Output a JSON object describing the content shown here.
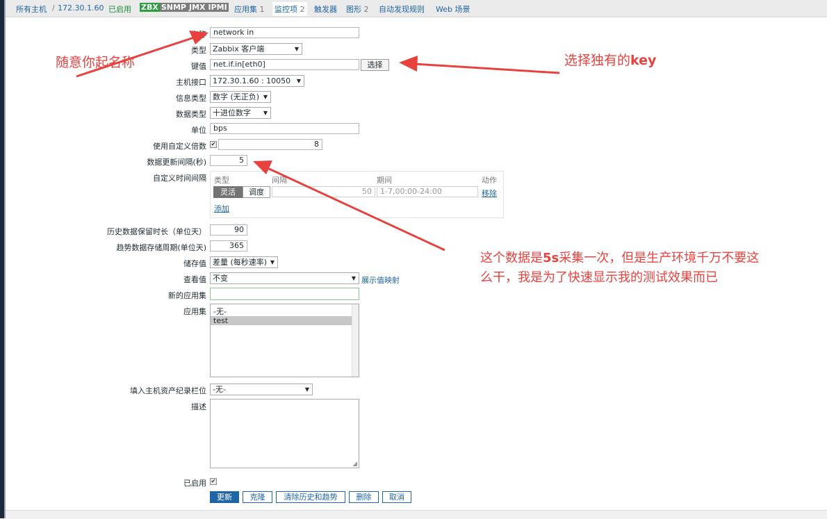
{
  "breadcrumb": {
    "all_hosts": "所有主机",
    "separator": "/",
    "host": "172.30.1.60",
    "status": "已启用",
    "zbx": "ZBX",
    "snmp": "SNMP",
    "jmx": "JMX",
    "ipmi": "IPMI",
    "applications": "应用集",
    "applications_count": "1",
    "items": "监控项",
    "items_count": "2",
    "triggers": "触发器",
    "graphs": "图形",
    "graphs_count": "2",
    "discovery": "自动发现规则",
    "web": "Web 场景"
  },
  "form": {
    "name_label": "名称",
    "name_value": "network in",
    "type_label": "类型",
    "type_value": "Zabbix 客户端",
    "key_label": "键值",
    "key_value": "net.if.in[eth0]",
    "select_button": "选择",
    "interface_label": "主机接口",
    "interface_value": "172.30.1.60 : 10050",
    "info_type_label": "信息类型",
    "info_type_value": "数字 (无正负)",
    "data_type_label": "数据类型",
    "data_type_value": "十进位数字",
    "units_label": "单位",
    "units_value": "bps",
    "multiplier_label": "使用自定义倍数",
    "multiplier_value": "8",
    "interval_label": "数据更新间隔(秒)",
    "interval_value": "5",
    "custom_interval_label": "自定义时间间隔",
    "custom_interval": {
      "col_type": "类型",
      "col_interval": "间隔",
      "col_period": "期间",
      "col_action": "动作",
      "flexible": "灵活",
      "scheduling": "调度",
      "interval_value": "50",
      "period_value": "1-7,00:00-24:00",
      "remove": "移除",
      "add": "添加"
    },
    "history_label": "历史数据保留时长（单位天）",
    "history_value": "90",
    "trends_label": "趋势数据存储周期(单位天)",
    "trends_value": "365",
    "store_label": "储存值",
    "store_value": "差量 (每秒速率)",
    "show_value_label": "查看值",
    "show_value_value": "不变",
    "show_value_link": "展示值映射",
    "new_app_label": "新的应用集",
    "new_app_value": "",
    "apps_label": "应用集",
    "apps_options": [
      "-无-",
      "test"
    ],
    "inventory_label": "填入主机资产纪录栏位",
    "inventory_value": "-无-",
    "description_label": "描述",
    "enabled_label": "已启用"
  },
  "buttons": {
    "update": "更新",
    "clone": "克隆",
    "clear": "清除历史和趋势",
    "delete": "删除",
    "cancel": "取消"
  },
  "annotations": {
    "name_hint": "随意你起名称",
    "key_hint_prefix": "选择独有的",
    "key_hint_key": "key",
    "interval_hint_line1_a": "这个数据是",
    "interval_hint_line1_b": "5s",
    "interval_hint_line1_c": "采集一次，但是生产环境千万不要这",
    "interval_hint_line2": "么干，我是为了快速显示我的测试效果而已"
  },
  "colors": {
    "annotation": "#e8423f",
    "link": "#1f65a6",
    "primary_button": "#1f65a6",
    "zbx_tag": "#2b9e3e"
  }
}
